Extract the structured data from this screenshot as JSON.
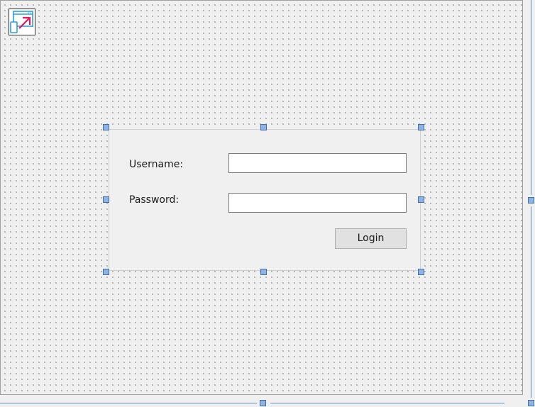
{
  "form": {
    "username_label": "Username:",
    "password_label": "Password:",
    "username_value": "",
    "password_value": "",
    "login_label": "Login"
  },
  "icons": {
    "form_icon": "responsive-form-icon"
  },
  "colors": {
    "canvas_bg": "#f0f0f0",
    "grid_dot": "#9a9a9a",
    "handle_fill": "#8fb4e3",
    "handle_border": "#3f6fb0",
    "icon_arrow": "#e5195f",
    "icon_frame": "#2b9fd9"
  }
}
